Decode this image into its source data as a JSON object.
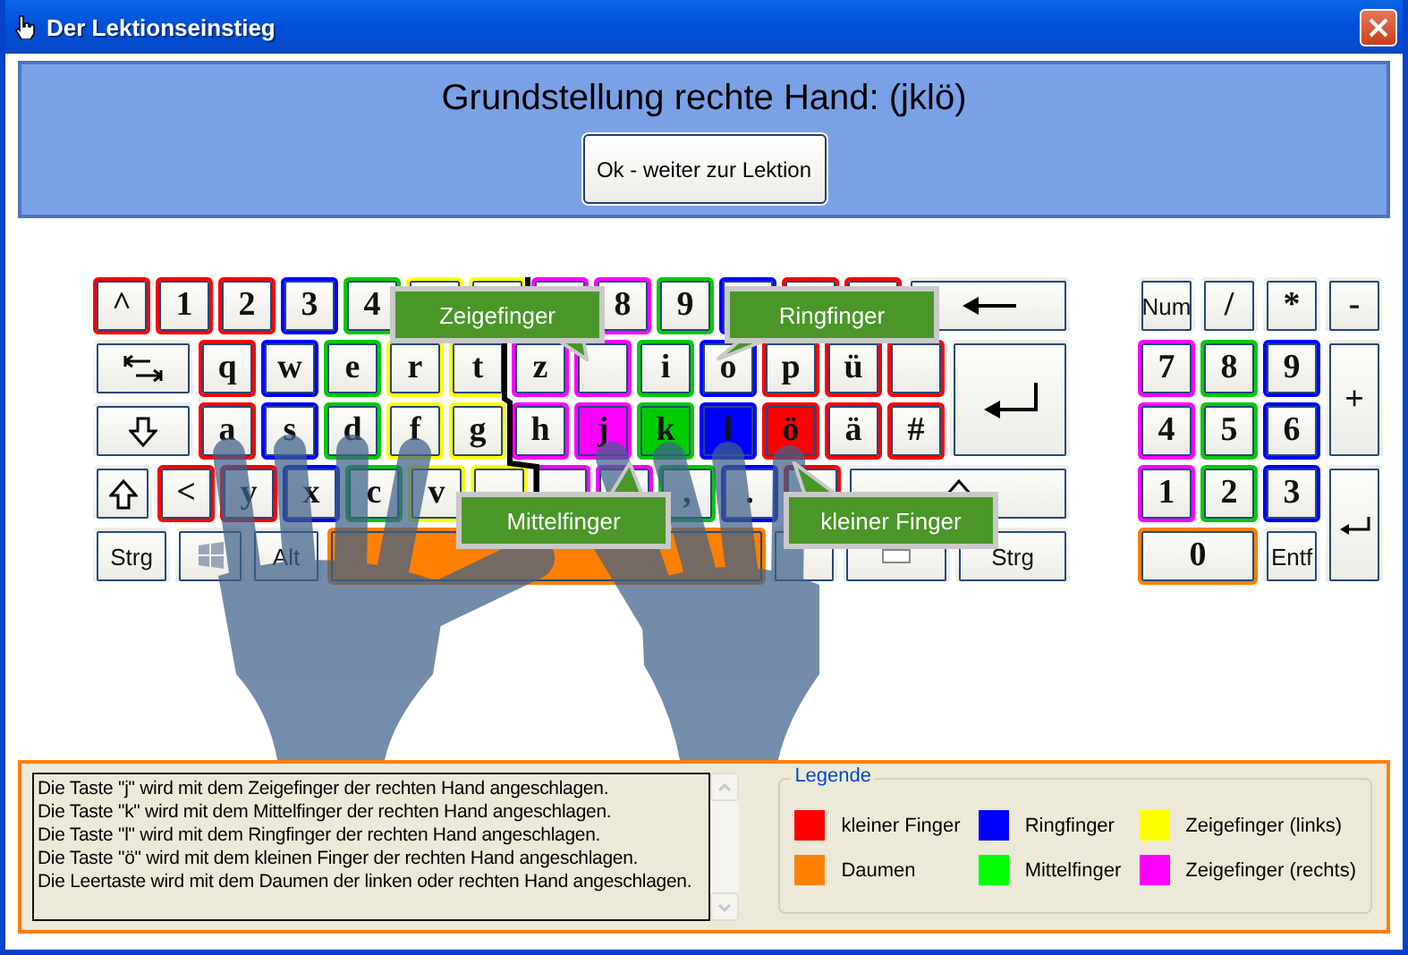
{
  "window": {
    "title": "Der Lektionseinstieg"
  },
  "header": {
    "title": "Grundstellung rechte Hand: (jklö)",
    "button": "Ok - weiter zur Lektion"
  },
  "keyboard": {
    "rows": [
      [
        {
          "kind": "char",
          "label": "^",
          "color": "#ff0000",
          "highlighted": false
        },
        {
          "kind": "char",
          "label": "1",
          "color": "#ff0000",
          "highlighted": false
        },
        {
          "kind": "char",
          "label": "2",
          "color": "#ff0000",
          "highlighted": false
        },
        {
          "kind": "char",
          "label": "3",
          "color": "#0000ff",
          "highlighted": false
        },
        {
          "kind": "char",
          "label": "4",
          "color": "#00cc00",
          "highlighted": false
        },
        {
          "kind": "char",
          "color": "#ffff00",
          "highlighted": false
        },
        {
          "kind": "char",
          "color": "#ffff00",
          "highlighted": false
        },
        {
          "kind": "char",
          "color": "#ff00ff",
          "highlighted": false
        },
        {
          "kind": "char",
          "label": "8",
          "color": "#ff00ff",
          "highlighted": false
        },
        {
          "kind": "char",
          "label": "9",
          "color": "#00cc00",
          "highlighted": false
        },
        {
          "kind": "char",
          "color": "#0000ff",
          "highlighted": false
        },
        {
          "kind": "char",
          "color": "#ff0000",
          "highlighted": false
        },
        {
          "kind": "char",
          "color": "#ff0000",
          "highlighted": false
        },
        {
          "kind": "backspace"
        }
      ],
      [
        {
          "kind": "tab"
        },
        {
          "kind": "char",
          "label": "q",
          "color": "#ff0000",
          "highlighted": false
        },
        {
          "kind": "char",
          "label": "w",
          "color": "#0000ff",
          "highlighted": false
        },
        {
          "kind": "char",
          "label": "e",
          "color": "#00cc00",
          "highlighted": false
        },
        {
          "kind": "char",
          "label": "r",
          "color": "#ffff00",
          "highlighted": false
        },
        {
          "kind": "char",
          "label": "t",
          "color": "#ffff00",
          "highlighted": false
        },
        {
          "kind": "char",
          "label": "z",
          "color": "#ff00ff",
          "highlighted": false
        },
        {
          "kind": "char",
          "color": "#ff00ff",
          "highlighted": false
        },
        {
          "kind": "char",
          "label": "i",
          "color": "#00cc00",
          "highlighted": false
        },
        {
          "kind": "char",
          "label": "o",
          "color": "#0000ff",
          "highlighted": false
        },
        {
          "kind": "char",
          "label": "p",
          "color": "#ff0000",
          "highlighted": false
        },
        {
          "kind": "char",
          "label": "ü",
          "color": "#ff0000",
          "highlighted": false
        },
        {
          "kind": "char",
          "color": "#ff0000",
          "highlighted": false
        }
      ],
      [
        {
          "kind": "caps"
        },
        {
          "kind": "char",
          "label": "a",
          "color": "#ff0000",
          "highlighted": false
        },
        {
          "kind": "char",
          "label": "s",
          "color": "#0000ff",
          "highlighted": false
        },
        {
          "kind": "char",
          "label": "d",
          "color": "#00cc00",
          "highlighted": false
        },
        {
          "kind": "char",
          "label": "f",
          "color": "#ffff00",
          "highlighted": false
        },
        {
          "kind": "char",
          "label": "g",
          "color": "#ffff00",
          "highlighted": false
        },
        {
          "kind": "char",
          "label": "h",
          "color": "#ff00ff",
          "highlighted": false
        },
        {
          "kind": "char",
          "label": "j",
          "color": "#ff00ff",
          "highlighted": true
        },
        {
          "kind": "char",
          "label": "k",
          "color": "#00cc00",
          "highlighted": true
        },
        {
          "kind": "char",
          "label": "l",
          "color": "#0000ff",
          "highlighted": true
        },
        {
          "kind": "char",
          "label": "ö",
          "color": "#ff0000",
          "highlighted": true
        },
        {
          "kind": "char",
          "label": "ä",
          "color": "#ff0000",
          "highlighted": false
        },
        {
          "kind": "char",
          "label": "#",
          "color": "#ff0000",
          "highlighted": false
        }
      ],
      [
        {
          "kind": "shift"
        },
        {
          "kind": "char",
          "label": "<",
          "color": "#ff0000",
          "highlighted": false
        },
        {
          "kind": "char",
          "label": "y",
          "color": "#ff0000",
          "highlighted": false
        },
        {
          "kind": "char",
          "label": "x",
          "color": "#0000ff",
          "highlighted": false
        },
        {
          "kind": "char",
          "label": "c",
          "color": "#00cc00",
          "highlighted": false
        },
        {
          "kind": "char",
          "label": "v",
          "color": "#ffff00",
          "highlighted": false
        },
        {
          "kind": "char",
          "color": "#ffff00",
          "highlighted": false
        },
        {
          "kind": "char",
          "color": "#ff00ff",
          "highlighted": false
        },
        {
          "kind": "char",
          "color": "#ff00ff",
          "highlighted": false
        },
        {
          "kind": "char",
          "label": ",",
          "color": "#00cc00",
          "highlighted": false
        },
        {
          "kind": "char",
          "label": ".",
          "color": "#0000ff",
          "highlighted": false
        },
        {
          "kind": "char",
          "color": "#ff0000",
          "highlighted": false
        },
        {
          "kind": "wideshift"
        }
      ],
      [
        {
          "kind": "text",
          "label": "Strg"
        },
        {
          "kind": "win"
        },
        {
          "kind": "text",
          "label": "Alt"
        },
        {
          "kind": "space",
          "color": "#ff8000",
          "highlighted": true
        },
        {
          "kind": "blank"
        },
        {
          "kind": "menu"
        },
        {
          "kind": "text",
          "label": "Strg"
        }
      ]
    ],
    "enter_key": {
      "kind": "enter"
    }
  },
  "numpad": [
    {
      "kind": "text",
      "label": "Num"
    },
    {
      "kind": "char",
      "label": "/"
    },
    {
      "kind": "char",
      "label": "*"
    },
    {
      "kind": "char",
      "label": "-"
    },
    {
      "kind": "char",
      "label": "7",
      "color": "#ff00ff",
      "highlighted": false
    },
    {
      "kind": "char",
      "label": "8",
      "color": "#00cc00",
      "highlighted": false
    },
    {
      "kind": "char",
      "label": "9",
      "color": "#0000ff",
      "highlighted": false
    },
    {
      "kind": "tallchar",
      "label": "+"
    },
    {
      "kind": "char",
      "label": "4",
      "color": "#ff00ff",
      "highlighted": false
    },
    {
      "kind": "char",
      "label": "5",
      "color": "#00cc00",
      "highlighted": false
    },
    {
      "kind": "char",
      "label": "6",
      "color": "#0000ff",
      "highlighted": false
    },
    {
      "kind": "char",
      "label": "1",
      "color": "#ff00ff",
      "highlighted": false
    },
    {
      "kind": "char",
      "label": "2",
      "color": "#00cc00",
      "highlighted": false
    },
    {
      "kind": "char",
      "label": "3",
      "color": "#0000ff",
      "highlighted": false
    },
    {
      "kind": "tallenter"
    },
    {
      "kind": "widechar",
      "label": "0",
      "color": "#ff8000",
      "highlighted": false
    },
    {
      "kind": "text",
      "label": "Entf"
    }
  ],
  "callouts": [
    {
      "label": "Zeigefinger"
    },
    {
      "label": "Ringfinger"
    },
    {
      "label": "Mittelfinger"
    },
    {
      "label": "kleiner Finger"
    }
  ],
  "instructions": [
    "Die Taste \"j\" wird mit dem Zeigefinger der rechten Hand angeschlagen.",
    "Die Taste \"k\" wird mit dem Mittelfinger der rechten Hand angeschlagen.",
    "Die Taste \"l\" wird mit dem Ringfinger der rechten Hand angeschlagen.",
    "Die Taste \"ö\" wird mit dem kleinen Finger der rechten Hand angeschlagen.",
    "Die Leertaste wird mit dem Daumen der linken oder rechten Hand angeschlagen."
  ],
  "legend": {
    "title": "Legende",
    "items": [
      {
        "label": "kleiner Finger",
        "color": "#ff0000"
      },
      {
        "label": "Ringfinger",
        "color": "#0000ff"
      },
      {
        "label": "Zeigefinger (links)",
        "color": "#ffff00"
      },
      {
        "label": "Daumen",
        "color": "#ff8000"
      },
      {
        "label": "Mittelfinger",
        "color": "#00ff00"
      },
      {
        "label": "Zeigefinger (rechts)",
        "color": "#ff00ff"
      }
    ]
  }
}
